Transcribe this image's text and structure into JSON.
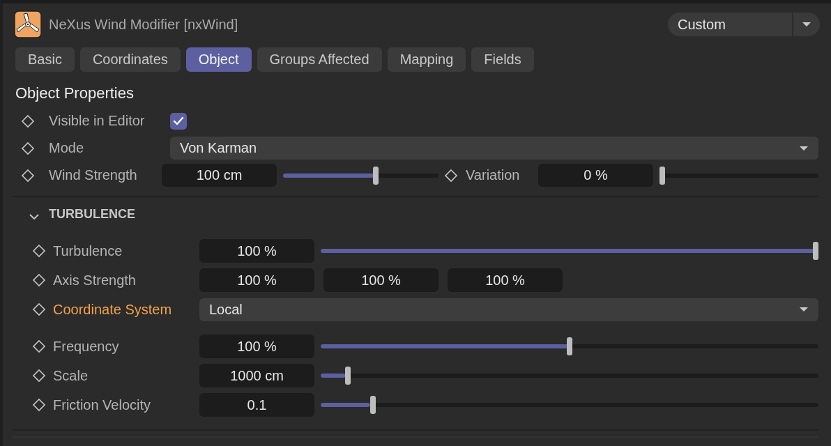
{
  "header": {
    "title": "NeXus Wind Modifier [nxWind]",
    "preset": "Custom"
  },
  "tabs": [
    {
      "label": "Basic",
      "selected": false
    },
    {
      "label": "Coordinates",
      "selected": false
    },
    {
      "label": "Object",
      "selected": true
    },
    {
      "label": "Groups Affected",
      "selected": false
    },
    {
      "label": "Mapping",
      "selected": false
    },
    {
      "label": "Fields",
      "selected": false
    }
  ],
  "section_title": "Object Properties",
  "properties": [
    {
      "kind": "checkbox",
      "label": "Visible in Editor",
      "checked": true
    },
    {
      "kind": "dropdown",
      "label": "Mode",
      "value": "Von Karman"
    },
    {
      "kind": "pair",
      "label": "Wind Strength",
      "value": "100 cm",
      "level": 0.6,
      "second": {
        "label": "Variation",
        "value": "0 %",
        "level": 0
      }
    }
  ],
  "turbulence": {
    "title": "TURBULENCE",
    "expanded": true,
    "rows": [
      {
        "kind": "slider",
        "label": "Turbulence",
        "value": "100 %",
        "level": 1,
        "highlighted": false
      },
      {
        "kind": "triple",
        "label": "Axis Strength",
        "values": [
          "100 %",
          "100 %",
          "100 %"
        ],
        "highlighted": false
      },
      {
        "kind": "dropdown",
        "label": "Coordinate System",
        "value": "Local",
        "highlighted": true
      },
      {
        "kind": "slider",
        "label": "Frequency",
        "value": "100 %",
        "level": 0.5,
        "highlighted": false
      },
      {
        "kind": "slider",
        "label": "Scale",
        "value": "1000 cm",
        "level": 0.05,
        "highlighted": false
      },
      {
        "kind": "slider",
        "label": "Friction Velocity",
        "value": "0.1",
        "level": 0.1,
        "highlighted": false
      }
    ]
  }
}
